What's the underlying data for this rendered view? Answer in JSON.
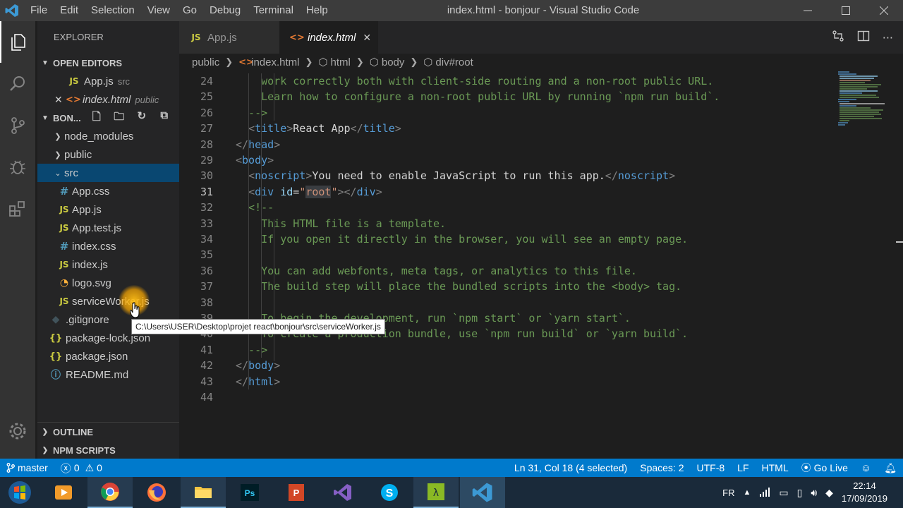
{
  "app": {
    "window_title": "index.html - bonjour - Visual Studio Code",
    "menu": [
      "File",
      "Edit",
      "Selection",
      "View",
      "Go",
      "Debug",
      "Terminal",
      "Help"
    ]
  },
  "sidebar": {
    "title": "EXPLORER",
    "open_editors_label": "OPEN EDITORS",
    "open_editors": [
      {
        "name": "App.js",
        "dir": "src",
        "icon": "js-file-icon"
      },
      {
        "name": "index.html",
        "dir": "public",
        "icon": "html-file-icon"
      }
    ],
    "project_label": "BON...",
    "tree": [
      {
        "name": "node_modules",
        "type": "folder"
      },
      {
        "name": "public",
        "type": "folder"
      },
      {
        "name": "src",
        "type": "folder-open"
      },
      {
        "name": "App.css",
        "type": "css"
      },
      {
        "name": "App.js",
        "type": "js"
      },
      {
        "name": "App.test.js",
        "type": "js"
      },
      {
        "name": "index.css",
        "type": "css"
      },
      {
        "name": "index.js",
        "type": "js"
      },
      {
        "name": "logo.svg",
        "type": "svg"
      },
      {
        "name": "serviceWorker.js",
        "type": "js"
      },
      {
        "name": ".gitignore",
        "type": "git"
      },
      {
        "name": "package-lock.json",
        "type": "json"
      },
      {
        "name": "package.json",
        "type": "json"
      },
      {
        "name": "README.md",
        "type": "info"
      }
    ],
    "outline_label": "OUTLINE",
    "npm_scripts_label": "NPM SCRIPTS"
  },
  "tabs": [
    {
      "label": "App.js",
      "icon": "js-file-icon",
      "active": false
    },
    {
      "label": "index.html",
      "icon": "html-file-icon",
      "active": true
    }
  ],
  "breadcrumbs": [
    "public",
    "index.html",
    "html",
    "body",
    "div#root"
  ],
  "code_lines": [
    {
      "n": "24",
      "text": "    work correctly both with client-side routing and a non-root public URL."
    },
    {
      "n": "25",
      "text": "    Learn how to configure a non-root public URL by running `npm run build`."
    },
    {
      "n": "26",
      "text": "  -->"
    },
    {
      "n": "27",
      "text": "  <title>React App</title>"
    },
    {
      "n": "28",
      "text": "</head>"
    },
    {
      "n": "29",
      "text": "<body>"
    },
    {
      "n": "30",
      "text": "  <noscript>You need to enable JavaScript to run this app.</noscript>"
    },
    {
      "n": "31",
      "text": "  <div id=\"root\"></div>"
    },
    {
      "n": "32",
      "text": "  <!--"
    },
    {
      "n": "33",
      "text": "    This HTML file is a template."
    },
    {
      "n": "34",
      "text": "    If you open it directly in the browser, you will see an empty page."
    },
    {
      "n": "35",
      "text": ""
    },
    {
      "n": "36",
      "text": "    You can add webfonts, meta tags, or analytics to this file."
    },
    {
      "n": "37",
      "text": "    The build step will place the bundled scripts into the <body> tag."
    },
    {
      "n": "38",
      "text": ""
    },
    {
      "n": "39",
      "text": "    To begin the development, run `npm start` or `yarn start`."
    },
    {
      "n": "40",
      "text": "    To create a production bundle, use `npm run build` or `yarn build`."
    },
    {
      "n": "41",
      "text": "  -->"
    },
    {
      "n": "42",
      "text": "</body>"
    },
    {
      "n": "43",
      "text": "</html>"
    },
    {
      "n": "44",
      "text": ""
    }
  ],
  "tooltip": "C:\\Users\\USER\\Desktop\\projet react\\bonjour\\src\\serviceWorker.js",
  "statusbar": {
    "branch": "master",
    "errors": "0",
    "warnings": "0",
    "cursor": "Ln 31, Col 18 (4 selected)",
    "spaces": "Spaces: 2",
    "encoding": "UTF-8",
    "eol": "LF",
    "language": "HTML",
    "golive": "Go Live"
  },
  "taskbar": {
    "lang": "FR",
    "time": "22:14",
    "date": "17/09/2019"
  },
  "colors": {
    "statusbar": "#007acc",
    "selection": "#094771",
    "activitybar": "#333333",
    "sidebar": "#252526",
    "editor": "#1e1e1e"
  }
}
